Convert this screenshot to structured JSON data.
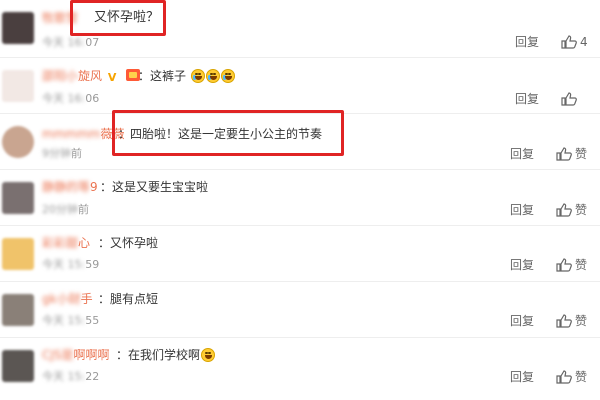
{
  "comments": [
    {
      "name_blurred": "牧歌雪",
      "text": "又怀孕啦？",
      "time_blurred": "今天 16:",
      "time_visible": "07",
      "reply": "回复",
      "like_label": "4"
    },
    {
      "name_blurred": "邵阳小",
      "name_visible": "旋风",
      "text": "：这裤子",
      "time_blurred": "今天 16:",
      "time_visible": "06",
      "reply": "回复",
      "like_label": ""
    },
    {
      "name_blurred": "mmmmm",
      "name_visible": "薇薇",
      "text": "：四胎啦！这是一定要生小公主的节奏",
      "time_blurred": "9分钟",
      "time_visible": "前",
      "reply": "回复",
      "like_label": "赞"
    },
    {
      "name_blurred": "静静的等",
      "name_visible": "9",
      "text": "：这是又要生宝宝啦",
      "time_blurred": "20分钟",
      "time_visible": "前",
      "reply": "回复",
      "like_label": "赞"
    },
    {
      "name_blurred": "彩彩甜",
      "name_visible": "心",
      "text": "：又怀孕啦",
      "time_blurred": "今天 15:",
      "time_visible": "59",
      "reply": "回复",
      "like_label": "赞"
    },
    {
      "name_blurred": "gk小财",
      "name_visible": "手",
      "text": "：腿有点短",
      "time_blurred": "今天 15:",
      "time_visible": "55",
      "reply": "回复",
      "like_label": "赞"
    },
    {
      "name_blurred": "CJS是",
      "name_visible": "啊啊啊",
      "text": "：在我们学校啊",
      "time_blurred": "今天 15:",
      "time_visible": "22",
      "reply": "回复",
      "like_label": "赞"
    }
  ],
  "colors": {
    "name": "#eb7350",
    "highlight": "#e02424",
    "avatar_0": "#4a3f3f",
    "avatar_1": "#f2e8e4",
    "avatar_2": "#c9a590",
    "avatar_3": "#7a7070",
    "avatar_4": "#f0c36a",
    "avatar_5": "#8a8078",
    "avatar_6": "#5b5653"
  },
  "icons": {
    "like": "thumbs-up-icon",
    "laugh": "laughing-tears-emoji",
    "grin": "grinning-emoji",
    "vip": "v-badge-icon",
    "crown": "crown-badge-icon"
  }
}
